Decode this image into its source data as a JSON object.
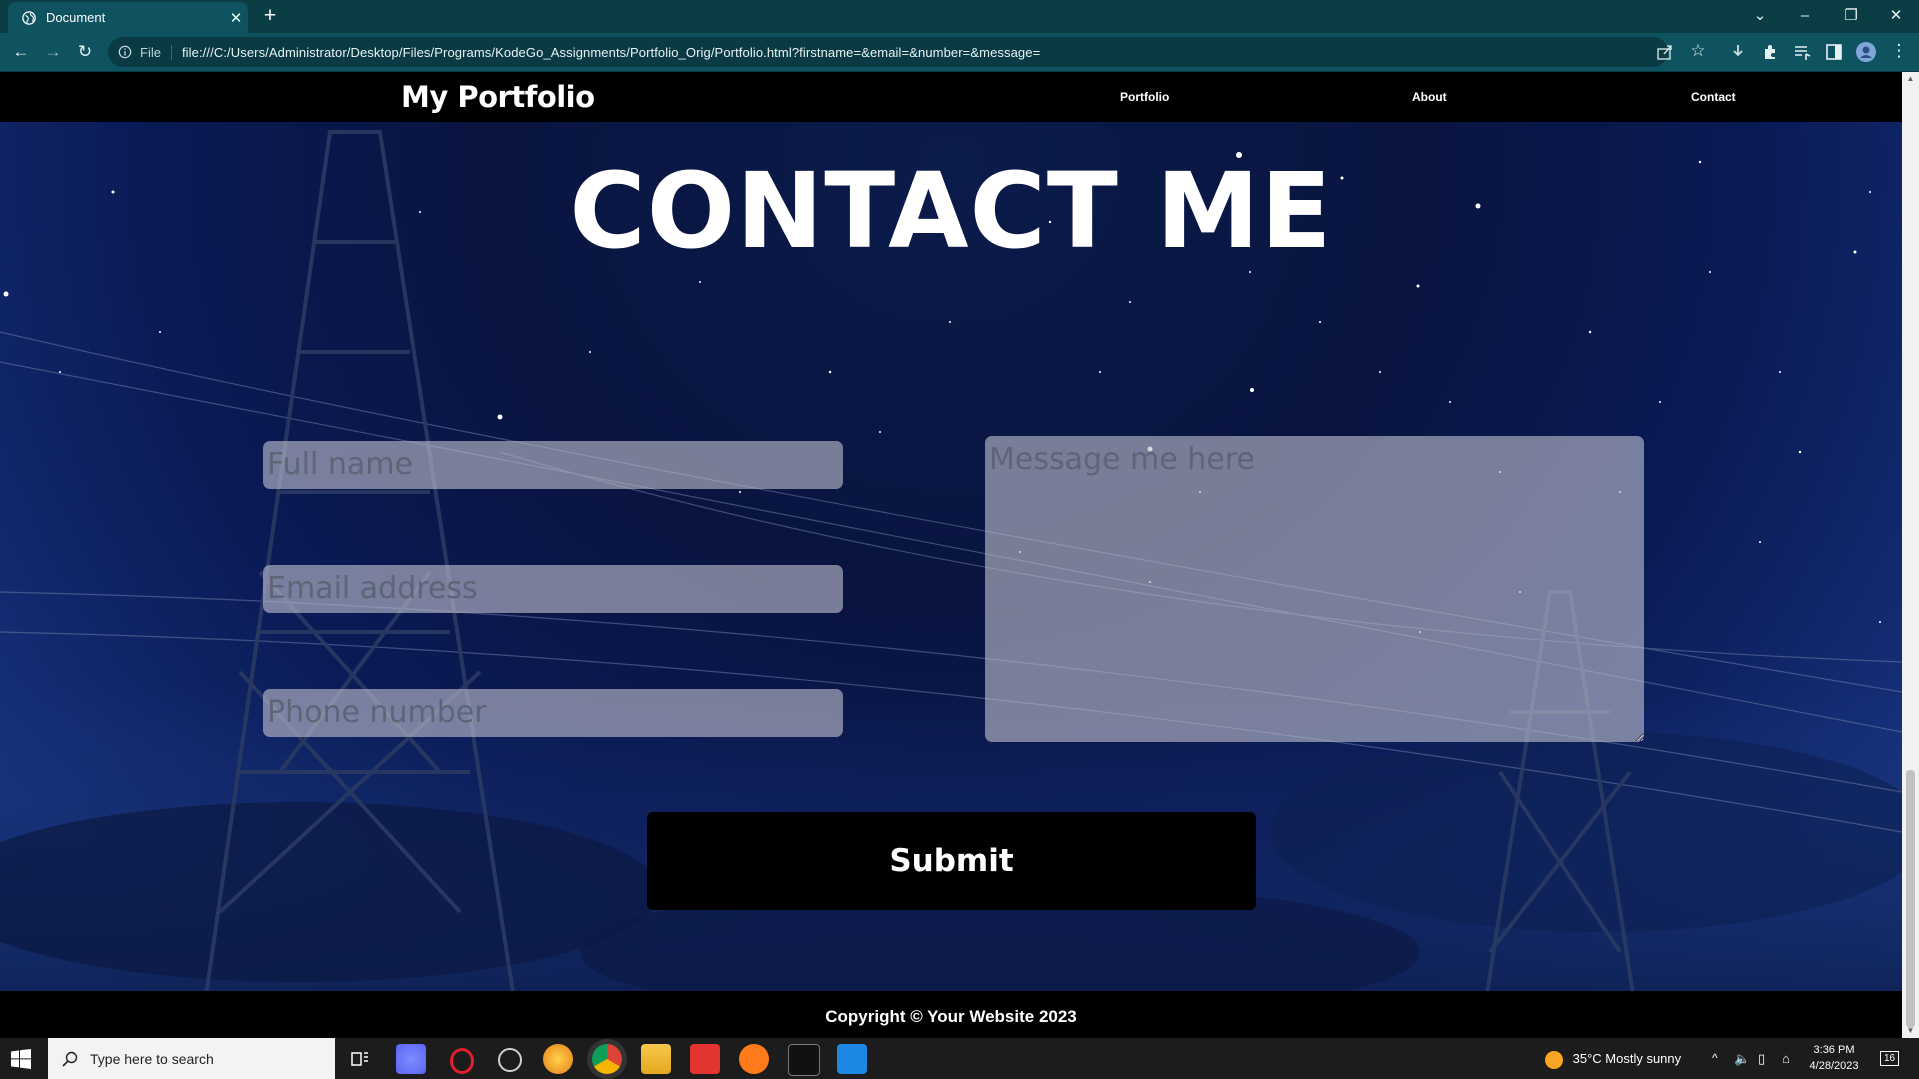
{
  "browser": {
    "tab_title": "Document",
    "tab_close": "✕",
    "new_tab": "+",
    "file_chip": "File",
    "url": "file:///C:/Users/Administrator/Desktop/Files/Programs/KodeGo_Assignments/Portfolio_Orig/Portfolio.html?firstname=&email=&number=&message=",
    "window_controls": [
      "⌄",
      "–",
      "❐",
      "✕"
    ]
  },
  "navbar": {
    "brand": "My Portfolio",
    "links": [
      "Portfolio",
      "About",
      "Contact"
    ]
  },
  "main": {
    "heading": "CONTACT ME",
    "full_name_placeholder": "Full name",
    "email_placeholder": "Email address",
    "phone_placeholder": "Phone number",
    "message_placeholder": "Message me here",
    "submit_label": "Submit"
  },
  "footer": {
    "text": "Copyright © Your Website 2023"
  },
  "taskbar": {
    "search_placeholder": "Type here to search",
    "weather": "35°C  Mostly sunny",
    "time": "3:36 PM",
    "date": "4/28/2023",
    "notifications": "16"
  },
  "colors": {
    "browser_frame": "#0b3d45",
    "toolbar": "#0f5260",
    "page_bg": "#0a1a55",
    "input_bg": "#bebecd",
    "button_bg": "#000000"
  }
}
